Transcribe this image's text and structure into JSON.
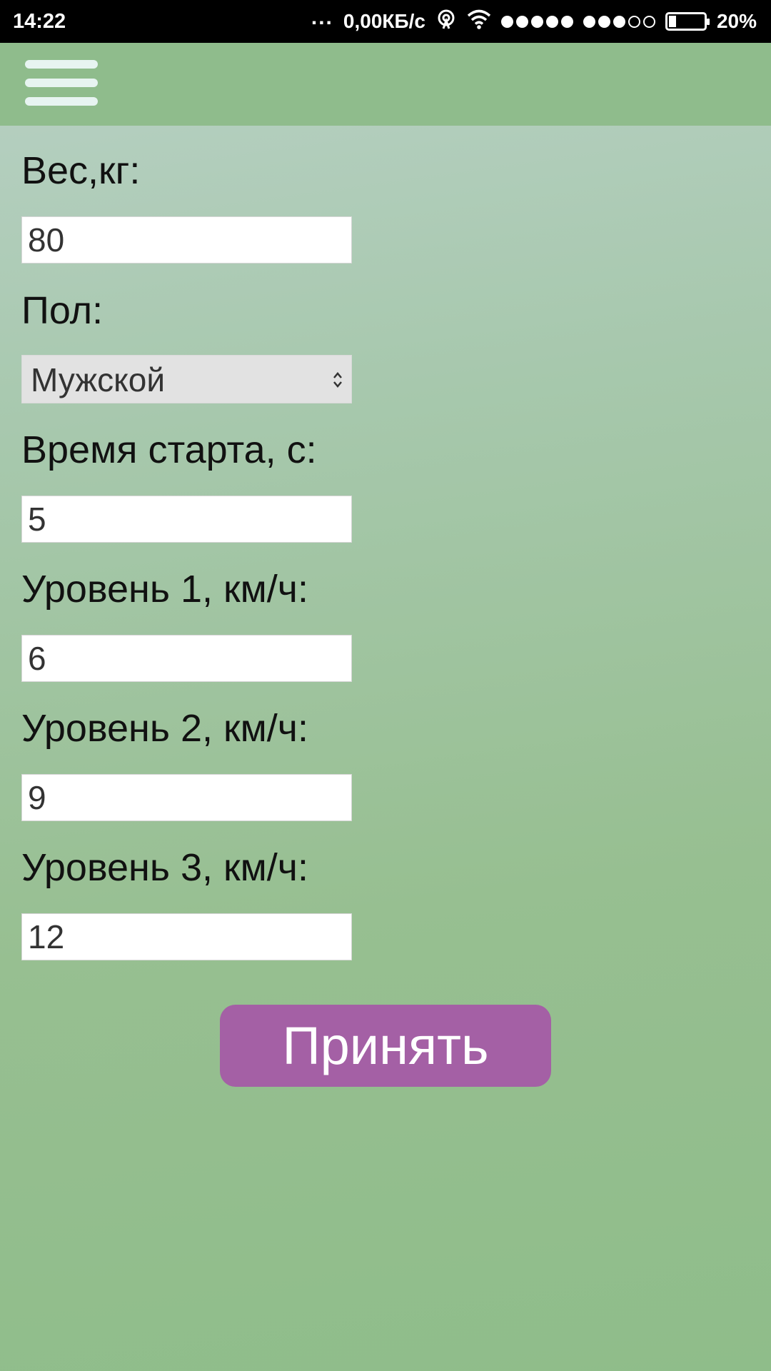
{
  "status_bar": {
    "time": "14:22",
    "more": "...",
    "network_speed": "0,00КБ/с",
    "battery_percent": "20%",
    "battery_level": 0.2,
    "icons": [
      "hotspot-icon",
      "wifi-icon",
      "signal-sim1-icon",
      "signal-sim2-icon",
      "battery-icon"
    ]
  },
  "app_bar": {
    "menu_icon": "hamburger-menu-icon"
  },
  "form": {
    "weight": {
      "label": "Вес,кг:",
      "value": "80"
    },
    "gender": {
      "label": "Пол:",
      "selected": "Мужской"
    },
    "start_time": {
      "label": "Время старта, с:",
      "value": "5"
    },
    "level1": {
      "label": "Уровень 1, км/ч:",
      "value": "6"
    },
    "level2": {
      "label": "Уровень 2, км/ч:",
      "value": "9"
    },
    "level3": {
      "label": "Уровень 3, км/ч:",
      "value": "12"
    },
    "submit_label": "Принять"
  },
  "colors": {
    "app_bar": "#8fbc8c",
    "button": "#a460a5",
    "background_top": "#b9d1c6",
    "background_bottom": "#8fbd8a"
  }
}
